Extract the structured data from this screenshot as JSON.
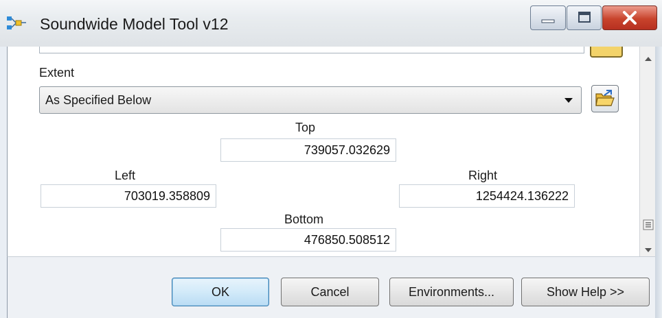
{
  "window": {
    "title": "Soundwide Model Tool v12"
  },
  "form": {
    "extent_label": "Extent",
    "extent_value": "As Specified Below",
    "top_label": "Top",
    "top_value": "739057.032629",
    "left_label": "Left",
    "left_value": "703019.358809",
    "right_label": "Right",
    "right_value": "1254424.136222",
    "bottom_label": "Bottom",
    "bottom_value": "476850.508512"
  },
  "buttons": {
    "ok": "OK",
    "cancel": "Cancel",
    "environments": "Environments...",
    "help": "Show Help >>"
  },
  "icons": {
    "app": "model-tool-icon",
    "folder": "open-folder-icon",
    "minimize": "minimize-icon",
    "maximize": "maximize-icon",
    "close": "close-icon"
  },
  "colors": {
    "ok_border": "#3c7fb1",
    "close_button": "#c8432c"
  }
}
